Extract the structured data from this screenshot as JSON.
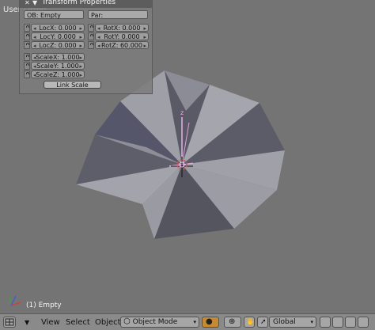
{
  "viewport": {
    "label": "User Ortho",
    "status": "(1) Empty"
  },
  "transform_panel": {
    "title": "Transform Properties",
    "ob_field": "OB: Empty",
    "par_field": "Par:",
    "loc": [
      "LocX: 0.000",
      "LocY: 0.000",
      "LocZ: 0.000"
    ],
    "rot": [
      "RotX: 0.000",
      "RotY: 0.000",
      "RotZ: 60.000"
    ],
    "scale": [
      "ScaleX: 1.000",
      "ScaleY: 1.000",
      "ScaleZ: 1.000"
    ],
    "link_scale_label": "Link Scale"
  },
  "header": {
    "menus": [
      "View",
      "Select",
      "Object"
    ],
    "mode": "Object Mode",
    "orientation": "Global"
  },
  "colors": {
    "viewport_bg": "#747474",
    "face_light": "#a6a6a6",
    "face_dark": "#55555f",
    "face_mid": "#80808a",
    "empty_axis": "#e0a8e0"
  }
}
